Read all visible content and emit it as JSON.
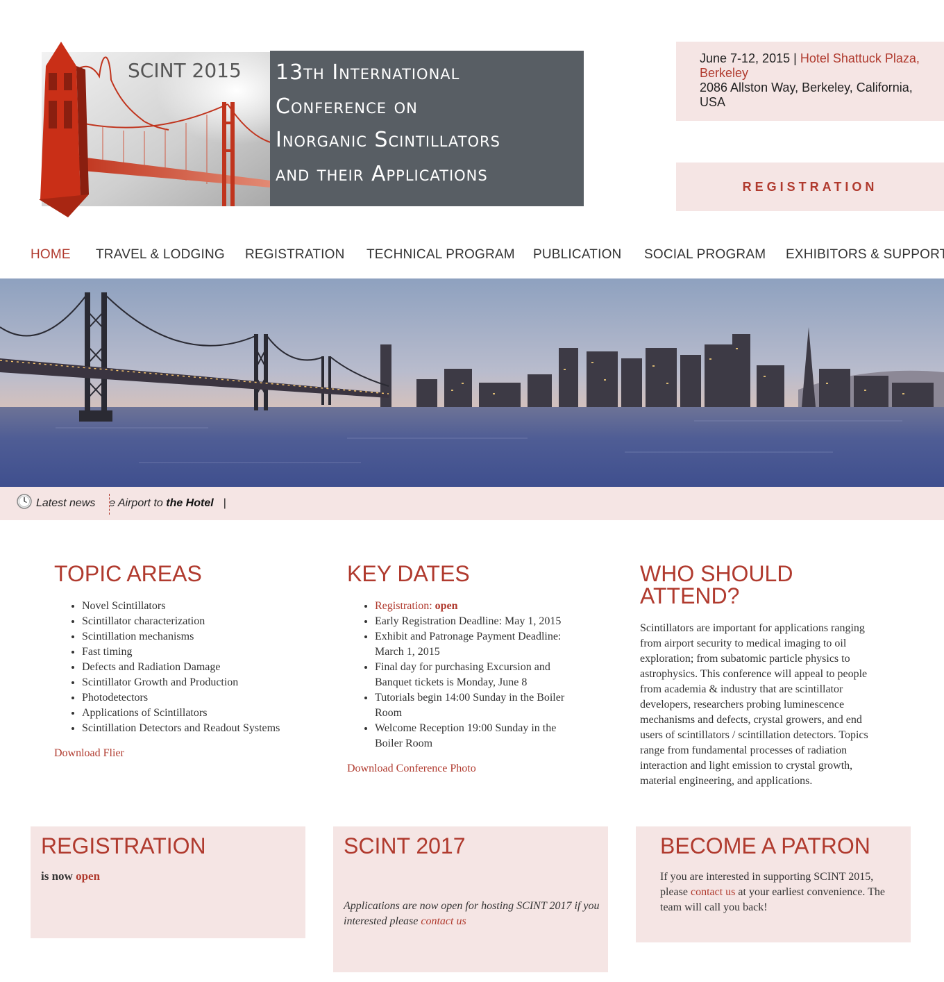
{
  "header": {
    "logo_tag": "SCINT 2015",
    "title_lines": [
      "13th International",
      "Conference on",
      "Inorganic Scintillators",
      "and their Applications"
    ],
    "event": {
      "dates": "June 7-12, 2015",
      "separator": "|",
      "venue": "Hotel Shattuck Plaza, Berkeley",
      "address": "2086 Allston Way,  Berkeley, California, USA"
    },
    "register_button": "REGISTRATION"
  },
  "nav": {
    "items": [
      "HOME",
      "TRAVEL & LODGING",
      "REGISTRATION",
      "TECHNICAL PROGRAM",
      "PUBLICATION",
      "SOCIAL PROGRAM",
      "EXHIBITORS & SUPPORTERS"
    ],
    "active": "HOME"
  },
  "ticker": {
    "label": "Latest news",
    "text_prefix": "m the Airport to ",
    "text_bold": "the Hotel",
    "bar": "|"
  },
  "topics": {
    "title": "TOPIC AREAS",
    "items": [
      "Novel Scintillators",
      "Scintillator characterization",
      "Scintillation mechanisms",
      "Fast timing",
      "Defects and Radiation Damage",
      "Scintillator Growth and Production",
      "Photodetectors",
      "Applications of Scintillators",
      "Scintillation Detectors and Readout Systems"
    ],
    "link": "Download Flier"
  },
  "dates": {
    "title": "KEY DATES",
    "registration_label": "Registration: ",
    "registration_status": "open",
    "items": [
      "Early Registration Deadline: May 1, 2015",
      "Exhibit and Patronage Payment Deadline: March 1, 2015",
      "Final day for purchasing Excursion and Banquet tickets is Monday, June 8",
      "Tutorials begin 14:00 Sunday in the Boiler Room",
      "Welcome Reception 19:00 Sunday in the Boiler Room"
    ],
    "link": "Download Conference Photo"
  },
  "who": {
    "title": "WHO SHOULD ATTEND?",
    "text": "Scintillators are important for applications ranging from airport security to medical imaging to oil exploration; from subatomic particle physics to astrophysics. This conference will appeal to people from academia & industry that are scintillator developers, researchers probing luminescence mechanisms and defects, crystal growers, and end users of scintillators / scintillation detectors. Topics range from fundamental processes of radiation interaction and light emission to crystal growth, material engineering, and applications."
  },
  "boxes": {
    "registration": {
      "title": "REGISTRATION",
      "text": "is now ",
      "link": "open"
    },
    "scint2017": {
      "title": "SCINT 2017",
      "text": "Applications are now open for hosting SCINT 2017 if you interested please ",
      "link": "contact us"
    },
    "patron": {
      "title": "BECOME A PATRON",
      "text_before": "If you are interested in supporting SCINT 2015, please ",
      "link": "contact us",
      "text_after": " at your earliest convenience. The team will call you back!"
    }
  },
  "colors": {
    "accent": "#b03a2e",
    "panel": "#f5e5e4",
    "title_box": "#585e64"
  }
}
